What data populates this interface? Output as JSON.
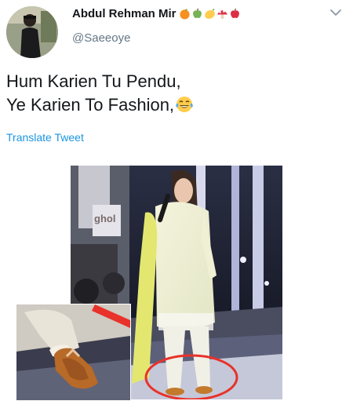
{
  "tweet": {
    "author": {
      "display_name": "Abdul Rehman Mir",
      "handle": "@Saeeoye",
      "name_emojis": [
        "orange-emoji",
        "green-apple-emoji",
        "lemon-emoji",
        "mushroom-emoji",
        "red-apple-emoji"
      ]
    },
    "text_lines": [
      "Hum Karien Tu Pendu,",
      "Ye Karien To Fashion,"
    ],
    "trailing_emoji": "laughing-tears-emoji",
    "translate_label": "Translate Tweet",
    "media": {
      "sign_text": "ghol",
      "highlight_color": "#e8322a"
    }
  },
  "colors": {
    "link": "#1b95e0",
    "text": "#14171a",
    "secondary": "#657786"
  }
}
